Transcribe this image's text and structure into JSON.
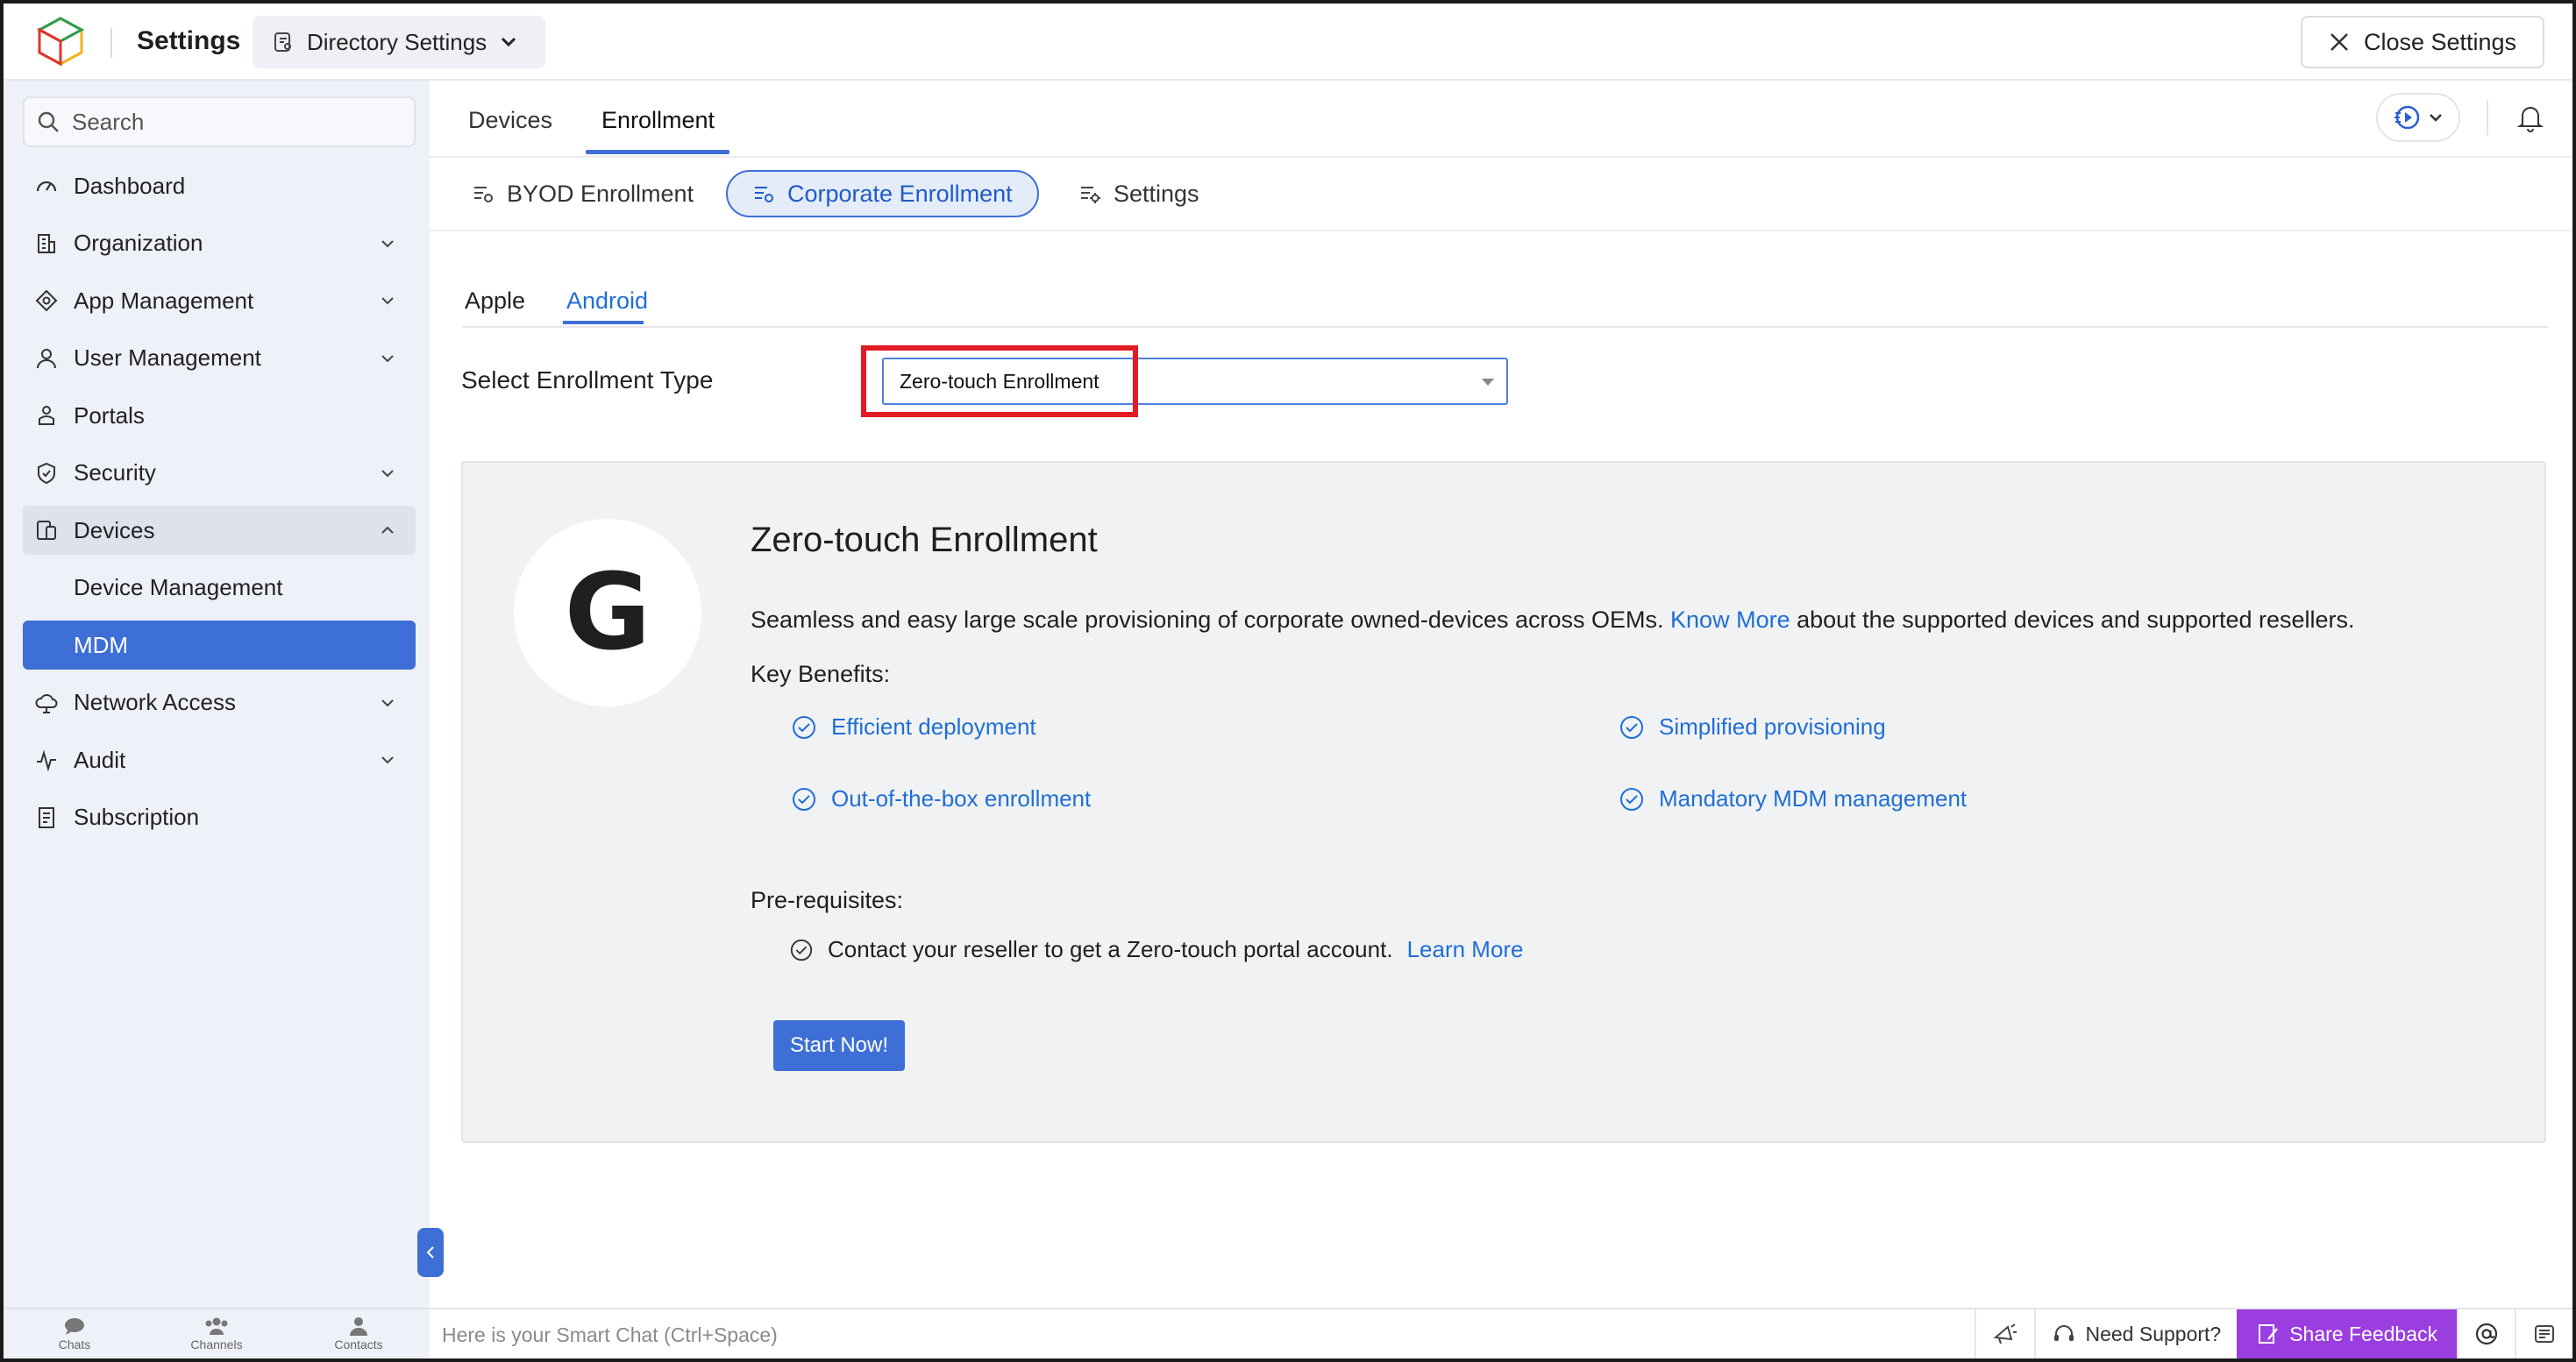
{
  "header": {
    "app_title": "Settings",
    "directory_chip": "Directory Settings",
    "close_label": "Close Settings"
  },
  "sidebar": {
    "search_placeholder": "Search",
    "items": [
      {
        "label": "Dashboard",
        "icon": "dashboard-icon",
        "expandable": false
      },
      {
        "label": "Organization",
        "icon": "organization-icon",
        "expandable": true
      },
      {
        "label": "App Management",
        "icon": "app-management-icon",
        "expandable": true
      },
      {
        "label": "User Management",
        "icon": "user-icon",
        "expandable": true
      },
      {
        "label": "Portals",
        "icon": "portal-icon",
        "expandable": false
      },
      {
        "label": "Security",
        "icon": "shield-icon",
        "expandable": true
      },
      {
        "label": "Devices",
        "icon": "devices-icon",
        "expandable": true,
        "expanded": true
      },
      {
        "label": "Device Management",
        "sub": true
      },
      {
        "label": "MDM",
        "sub": true,
        "active": true
      },
      {
        "label": "Network Access",
        "icon": "cloud-icon",
        "expandable": true
      },
      {
        "label": "Audit",
        "icon": "activity-icon",
        "expandable": true
      },
      {
        "label": "Subscription",
        "icon": "receipt-icon",
        "expandable": false
      }
    ]
  },
  "main": {
    "top_tabs": [
      {
        "label": "Devices",
        "active": false
      },
      {
        "label": "Enrollment",
        "active": true
      }
    ],
    "sub_tabs": [
      {
        "label": "BYOD Enrollment",
        "active": false
      },
      {
        "label": "Corporate Enrollment",
        "active": true
      },
      {
        "label": "Settings",
        "active": false
      }
    ],
    "platform_tabs": [
      {
        "label": "Apple",
        "active": false
      },
      {
        "label": "Android",
        "active": true
      }
    ],
    "enrollment_type_label": "Select Enrollment Type",
    "enrollment_type_value": "Zero-touch Enrollment"
  },
  "panel": {
    "logo_letter": "G",
    "title": "Zero-touch Enrollment",
    "desc_before": "Seamless and easy large scale provisioning of corporate owned-devices across OEMs.",
    "desc_link": "Know More",
    "desc_after": "about the supported devices and supported resellers.",
    "key_benefits_label": "Key Benefits:",
    "benefits": [
      "Efficient deployment",
      "Simplified provisioning",
      "Out-of-the-box enrollment",
      "Mandatory MDM management"
    ],
    "prereq_label": "Pre-requisites:",
    "prereq_text": "Contact your reseller to get a Zero-touch portal account.",
    "prereq_link": "Learn More",
    "start_label": "Start Now!"
  },
  "bottombar": {
    "chats": "Chats",
    "channels": "Channels",
    "contacts": "Contacts",
    "smartchat_placeholder": "Here is your Smart Chat (Ctrl+Space)",
    "need_support": "Need Support?",
    "share_feedback": "Share Feedback"
  },
  "colors": {
    "accent": "#3e6fd6",
    "link": "#1f6fd6",
    "highlight": "#e21b24",
    "feedback": "#9b3ee0"
  }
}
